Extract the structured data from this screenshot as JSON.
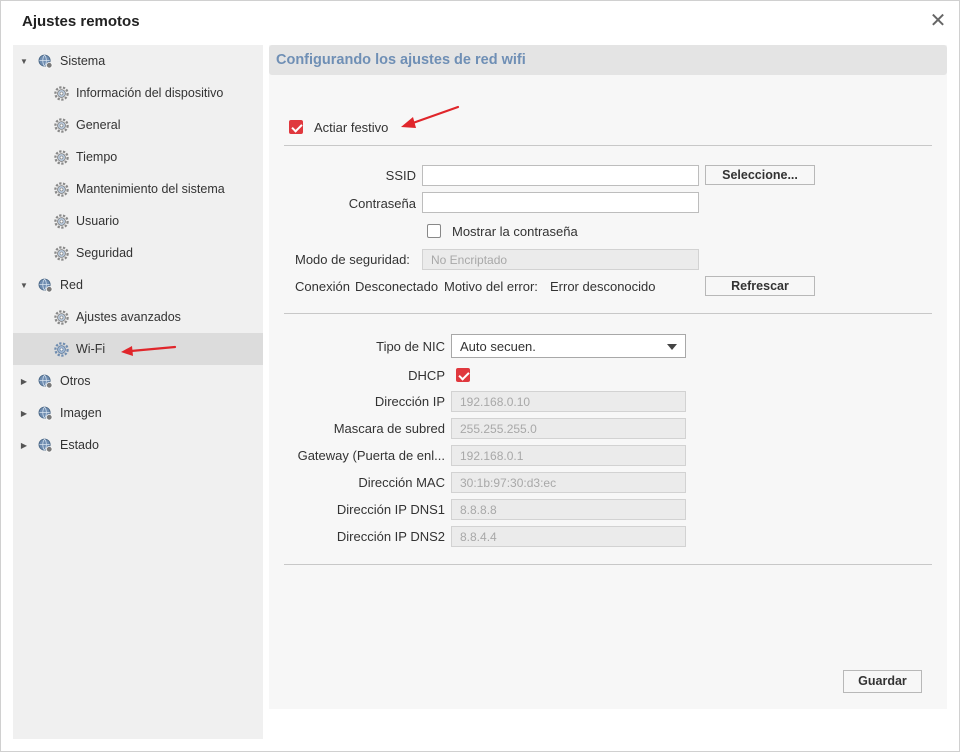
{
  "window": {
    "title": "Ajustes remotos"
  },
  "sidebar": {
    "items": [
      {
        "label": "Sistema"
      },
      {
        "label": "Información del dispositivo"
      },
      {
        "label": "General"
      },
      {
        "label": "Tiempo"
      },
      {
        "label": "Mantenimiento del sistema"
      },
      {
        "label": "Usuario"
      },
      {
        "label": "Seguridad"
      },
      {
        "label": "Red"
      },
      {
        "label": "Ajustes avanzados"
      },
      {
        "label": "Wi-Fi"
      },
      {
        "label": "Otros"
      },
      {
        "label": "Imagen"
      },
      {
        "label": "Estado"
      }
    ]
  },
  "main": {
    "header": "Configurando los ajustes de red wifi",
    "enable_label": "Actiar festivo",
    "ssid_label": "SSID",
    "ssid_value": "",
    "select_button": "Seleccione...",
    "password_label": "Contraseña",
    "password_value": "",
    "show_password_label": "Mostrar la contraseña",
    "security_mode_label": "Modo de seguridad:",
    "security_mode_value": "No Encriptado",
    "connection_label": "Conexión",
    "connection_status": "Desconectado",
    "error_label": "Motivo del error:",
    "error_value": "Error desconocido",
    "refresh_button": "Refrescar",
    "nic_label": "Tipo de NIC",
    "nic_value": "Auto secuen.",
    "dhcp_label": "DHCP",
    "ip_label": "Dirección IP",
    "ip_value": "192.168.0.10",
    "mask_label": "Mascara de subred",
    "mask_value": "255.255.255.0",
    "gateway_label": "Gateway (Puerta de enl...",
    "gateway_value": "192.168.0.1",
    "mac_label": "Dirección MAC",
    "mac_value": "30:1b:97:30:d3:ec",
    "dns1_label": "Dirección IP DNS1",
    "dns1_value": "8.8.8.8",
    "dns2_label": "Dirección IP DNS2",
    "dns2_value": "8.8.4.4",
    "save_button": "Guardar"
  },
  "colors": {
    "accent": "#e0383e",
    "header_text": "#6f8fb5",
    "annotation_arrow": "#e0262b"
  },
  "icons": {
    "tree_root": "globe-gear-icon",
    "tree_child": "gear-icon",
    "close": "close-icon"
  }
}
